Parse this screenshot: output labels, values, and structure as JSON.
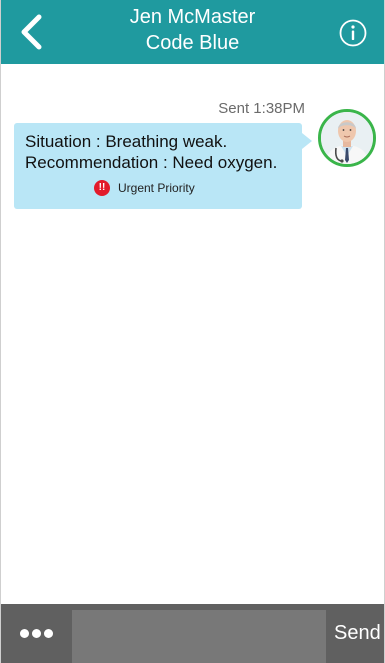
{
  "header": {
    "title": "Jen McMaster",
    "subtitle": "Code Blue",
    "back_icon": "chevron-left-icon",
    "info_icon": "info-icon",
    "color": "#1f9a9f"
  },
  "messages": [
    {
      "sent_label": "Sent 1:38PM",
      "lines": [
        "Situation : Breathing weak.",
        "Recommendation : Need oxygen."
      ],
      "priority_icon_glyph": "!!",
      "priority_label": "Urgent Priority",
      "bubble_color": "#b9e6f6",
      "avatar": "doctor-avatar"
    }
  ],
  "composer": {
    "more_icon": "more-dots-icon",
    "input_value": "",
    "input_placeholder": "",
    "send_label": "Send",
    "bar_color": "#606060"
  }
}
